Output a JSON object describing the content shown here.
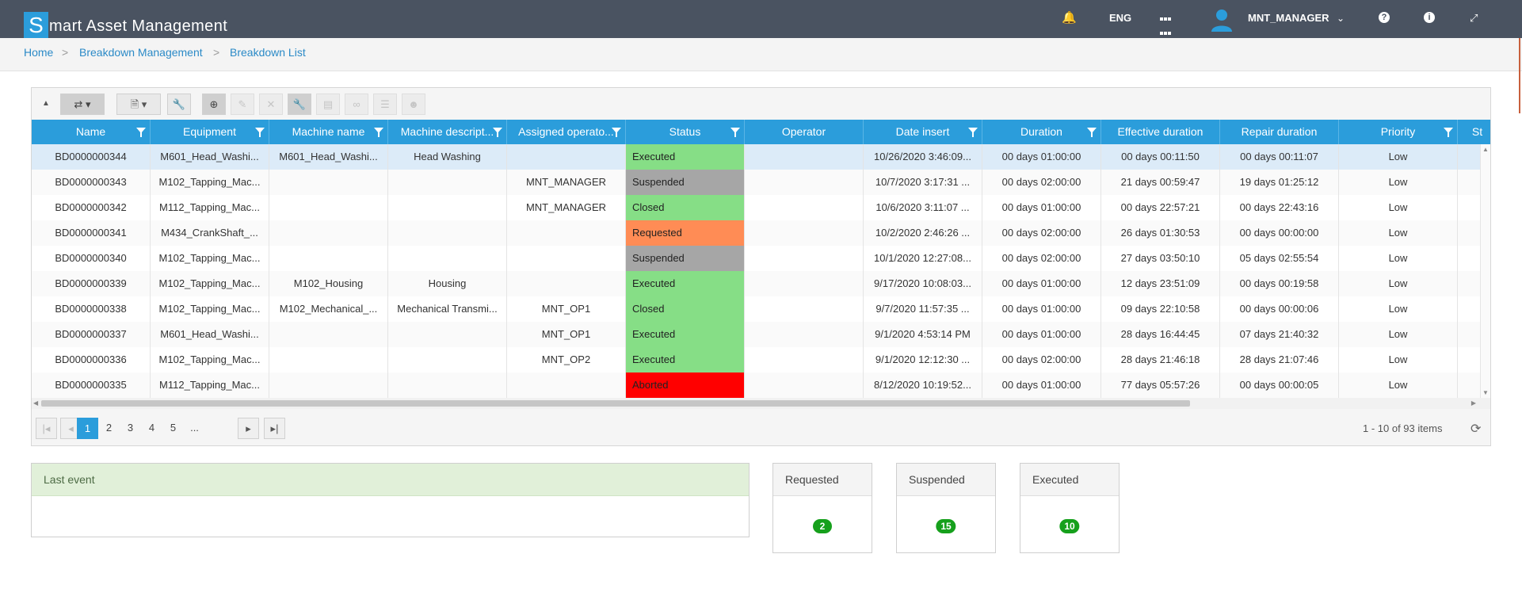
{
  "app": {
    "logo_letter": "S",
    "title": "mart Asset Management",
    "language": "ENG",
    "user": "MNT_MANAGER"
  },
  "breadcrumb": [
    "Home",
    "Breakdown Management",
    "Breakdown List"
  ],
  "grid": {
    "columns": [
      {
        "label": "Name",
        "filter": true
      },
      {
        "label": "Equipment",
        "filter": true
      },
      {
        "label": "Machine name",
        "filter": true
      },
      {
        "label": "Machine descript...",
        "filter": true
      },
      {
        "label": "Assigned operato...",
        "filter": true
      },
      {
        "label": "Status",
        "filter": true
      },
      {
        "label": "Operator",
        "filter": false
      },
      {
        "label": "Date insert",
        "filter": true
      },
      {
        "label": "Duration",
        "filter": true
      },
      {
        "label": "Effective duration",
        "filter": false
      },
      {
        "label": "Repair duration",
        "filter": false
      },
      {
        "label": "Priority",
        "filter": true
      },
      {
        "label": "St",
        "filter": false
      }
    ],
    "rows": [
      [
        "BD0000000344",
        "M601_Head_Washi...",
        "M601_Head_Washi...",
        "Head Washing",
        "",
        "Executed",
        "",
        "10/26/2020 3:46:09...",
        "00 days 01:00:00",
        "00 days 00:11:50",
        "00 days 00:11:07",
        "Low"
      ],
      [
        "BD0000000343",
        "M102_Tapping_Mac...",
        "",
        "",
        "MNT_MANAGER",
        "Suspended",
        "",
        "10/7/2020 3:17:31 ...",
        "00 days 02:00:00",
        "21 days 00:59:47",
        "19 days 01:25:12",
        "Low"
      ],
      [
        "BD0000000342",
        "M112_Tapping_Mac...",
        "",
        "",
        "MNT_MANAGER",
        "Closed",
        "",
        "10/6/2020 3:11:07 ...",
        "00 days 01:00:00",
        "00 days 22:57:21",
        "00 days 22:43:16",
        "Low"
      ],
      [
        "BD0000000341",
        "M434_CrankShaft_...",
        "",
        "",
        "",
        "Requested",
        "",
        "10/2/2020 2:46:26 ...",
        "00 days 02:00:00",
        "26 days 01:30:53",
        "00 days 00:00:00",
        "Low"
      ],
      [
        "BD0000000340",
        "M102_Tapping_Mac...",
        "",
        "",
        "",
        "Suspended",
        "",
        "10/1/2020 12:27:08...",
        "00 days 02:00:00",
        "27 days 03:50:10",
        "05 days 02:55:54",
        "Low"
      ],
      [
        "BD0000000339",
        "M102_Tapping_Mac...",
        "M102_Housing",
        "Housing",
        "",
        "Executed",
        "",
        "9/17/2020 10:08:03...",
        "00 days 01:00:00",
        "12 days 23:51:09",
        "00 days 00:19:58",
        "Low"
      ],
      [
        "BD0000000338",
        "M102_Tapping_Mac...",
        "M102_Mechanical_...",
        "Mechanical Transmi...",
        "MNT_OP1",
        "Closed",
        "",
        "9/7/2020 11:57:35 ...",
        "00 days 01:00:00",
        "09 days 22:10:58",
        "00 days 00:00:06",
        "Low"
      ],
      [
        "BD0000000337",
        "M601_Head_Washi...",
        "",
        "",
        "MNT_OP1",
        "Executed",
        "",
        "9/1/2020 4:53:14 PM",
        "00 days 01:00:00",
        "28 days 16:44:45",
        "07 days 21:40:32",
        "Low"
      ],
      [
        "BD0000000336",
        "M102_Tapping_Mac...",
        "",
        "",
        "MNT_OP2",
        "Executed",
        "",
        "9/1/2020 12:12:30 ...",
        "00 days 02:00:00",
        "28 days 21:46:18",
        "28 days 21:07:46",
        "Low"
      ],
      [
        "BD0000000335",
        "M112_Tapping_Mac...",
        "",
        "",
        "",
        "Aborted",
        "",
        "8/12/2020 10:19:52...",
        "00 days 01:00:00",
        "77 days 05:57:26",
        "00 days 00:00:05",
        "Low"
      ]
    ],
    "status_colors": {
      "Executed": "#86de86",
      "Closed": "#86de86",
      "Suspended": "#a6a6a6",
      "Requested": "#ff8c55",
      "Aborted": "#ff0000"
    },
    "selected_row": 0
  },
  "pager": {
    "pages": [
      "1",
      "2",
      "3",
      "4",
      "5",
      "..."
    ],
    "current": "1",
    "info": "1 - 10 of 93 items"
  },
  "last_event": {
    "title": "Last event",
    "body": ""
  },
  "stats": [
    {
      "label": "Requested",
      "count": "2"
    },
    {
      "label": "Suspended",
      "count": "15"
    },
    {
      "label": "Executed",
      "count": "10"
    }
  ],
  "colors": {
    "accent": "#2b9ddb",
    "topbar": "#4a5361",
    "badge": "#16a01c"
  }
}
